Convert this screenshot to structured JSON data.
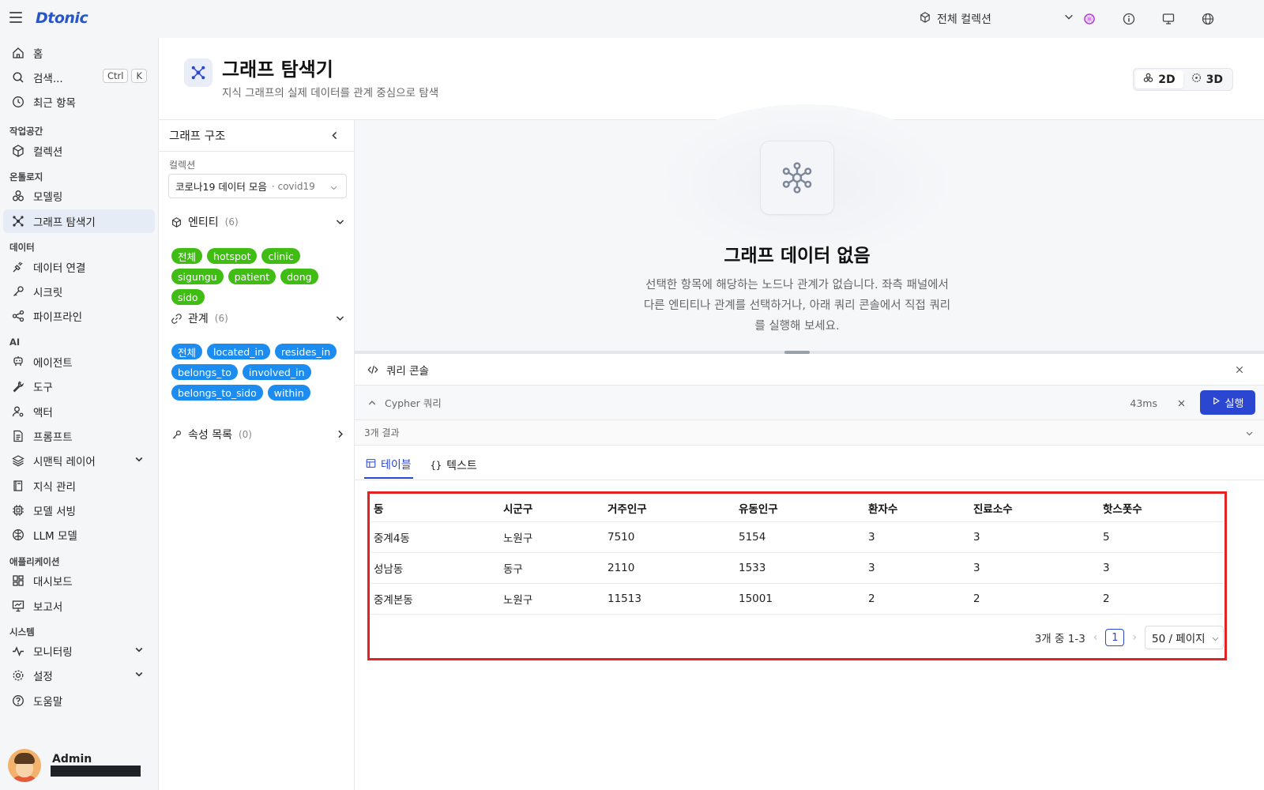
{
  "header": {
    "logo": "Dtonic",
    "collection_select": "전체 컬렉션",
    "icons": [
      "chevron-down-icon",
      "wheel-icon",
      "info-icon",
      "monitor-icon",
      "globe-icon"
    ]
  },
  "sidebar": {
    "home": "홈",
    "search": "검색...",
    "search_kbd": [
      "Ctrl",
      "K"
    ],
    "recent": "최근 항목",
    "groups": {
      "workspace": "작업공간",
      "ontology": "온톨로지",
      "data": "데이터",
      "ai": "AI",
      "apps": "애플리케이션",
      "system": "시스템"
    },
    "items": {
      "collection": "컬렉션",
      "modeling": "모델링",
      "graph_explorer": "그래프 탐색기",
      "data_connection": "데이터 연결",
      "secret": "시크릿",
      "pipeline": "파이프라인",
      "agent": "에이전트",
      "tool": "도구",
      "actor": "액터",
      "prompt": "프롬프트",
      "semantic_layer": "시맨틱 레이어",
      "knowledge": "지식 관리",
      "model_serving": "모델 서빙",
      "llm_model": "LLM 모델",
      "dashboard": "대시보드",
      "report": "보고서",
      "monitoring": "모니터링",
      "settings": "설정",
      "help": "도움말"
    },
    "user": {
      "name": "Admin"
    }
  },
  "page": {
    "title": "그래프 탐색기",
    "subtitle": "지식 그래프의 실제 데이터를 관계 중심으로 탐색",
    "toggle": [
      "2D",
      "3D"
    ]
  },
  "structure": {
    "title": "그래프 구조",
    "collection_label": "컬렉션",
    "collection_value": "코로나19 데이터 모음",
    "collection_sub": "· covid19",
    "entities": {
      "label": "엔티티",
      "count": "(6)",
      "tags": [
        "전체",
        "hotspot",
        "clinic",
        "sigungu",
        "patient",
        "dong",
        "sido"
      ]
    },
    "relations": {
      "label": "관계",
      "count": "(6)",
      "tags": [
        "전체",
        "located_in",
        "resides_in",
        "belongs_to",
        "involved_in",
        "belongs_to_sido",
        "within"
      ]
    },
    "properties": {
      "label": "속성 목록",
      "count": "(0)"
    }
  },
  "empty": {
    "title": "그래프 데이터 없음",
    "description": "선택한 항목에 해당하는 노드나 관계가 없습니다. 좌측 패널에서 다른 엔티티나 관계를 선택하거나, 아래 쿼리 콘솔에서 직접 쿼리를 실행해 보세요."
  },
  "console": {
    "title": "쿼리 콘솔",
    "query_label": "Cypher 쿼리",
    "time": "43ms",
    "run": "실행",
    "result_count": "3개 결과",
    "tabs": [
      "테이블",
      "텍스트"
    ]
  },
  "table": {
    "columns": [
      "동",
      "시군구",
      "거주인구",
      "유동인구",
      "환자수",
      "진료소수",
      "핫스폿수"
    ],
    "rows": [
      [
        "중계4동",
        "노원구",
        "7510",
        "5154",
        "3",
        "3",
        "5"
      ],
      [
        "성남동",
        "동구",
        "2110",
        "1533",
        "3",
        "3",
        "3"
      ],
      [
        "중계본동",
        "노원구",
        "11513",
        "15001",
        "2",
        "2",
        "2"
      ]
    ]
  },
  "pager": {
    "summary": "3개 중 1-3",
    "page": "1",
    "page_size": "50 / 페이지"
  }
}
